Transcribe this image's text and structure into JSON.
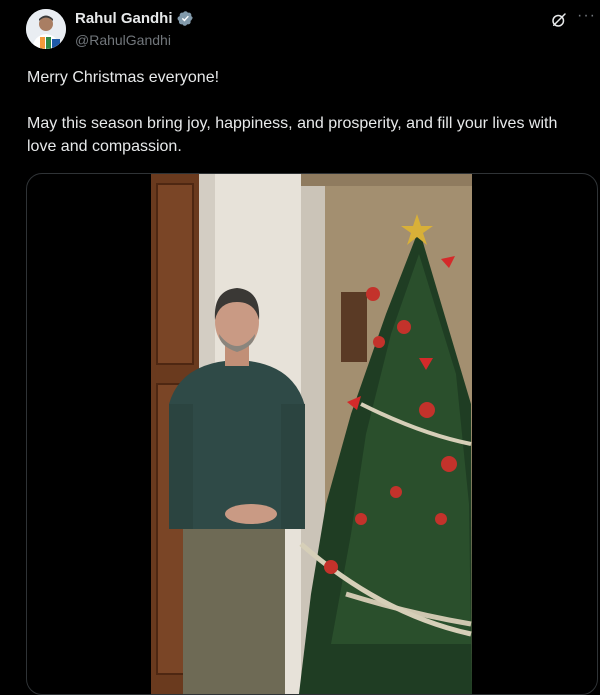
{
  "author": {
    "name": "Rahul Gandhi",
    "handle": "@RahulGandhi",
    "verified_color": "#829aab"
  },
  "header_icons": [
    "grok-icon",
    "more-icon"
  ],
  "tweet": {
    "paragraphs": [
      "Merry Christmas everyone!",
      "May this season bring joy, happiness, and prosperity, and fill your lives with love and compassion."
    ]
  },
  "colors": {
    "background": "#000000",
    "text": "#e7e9ea",
    "muted": "#71767b",
    "border": "#2f3336"
  },
  "icons": {
    "more": "···"
  }
}
